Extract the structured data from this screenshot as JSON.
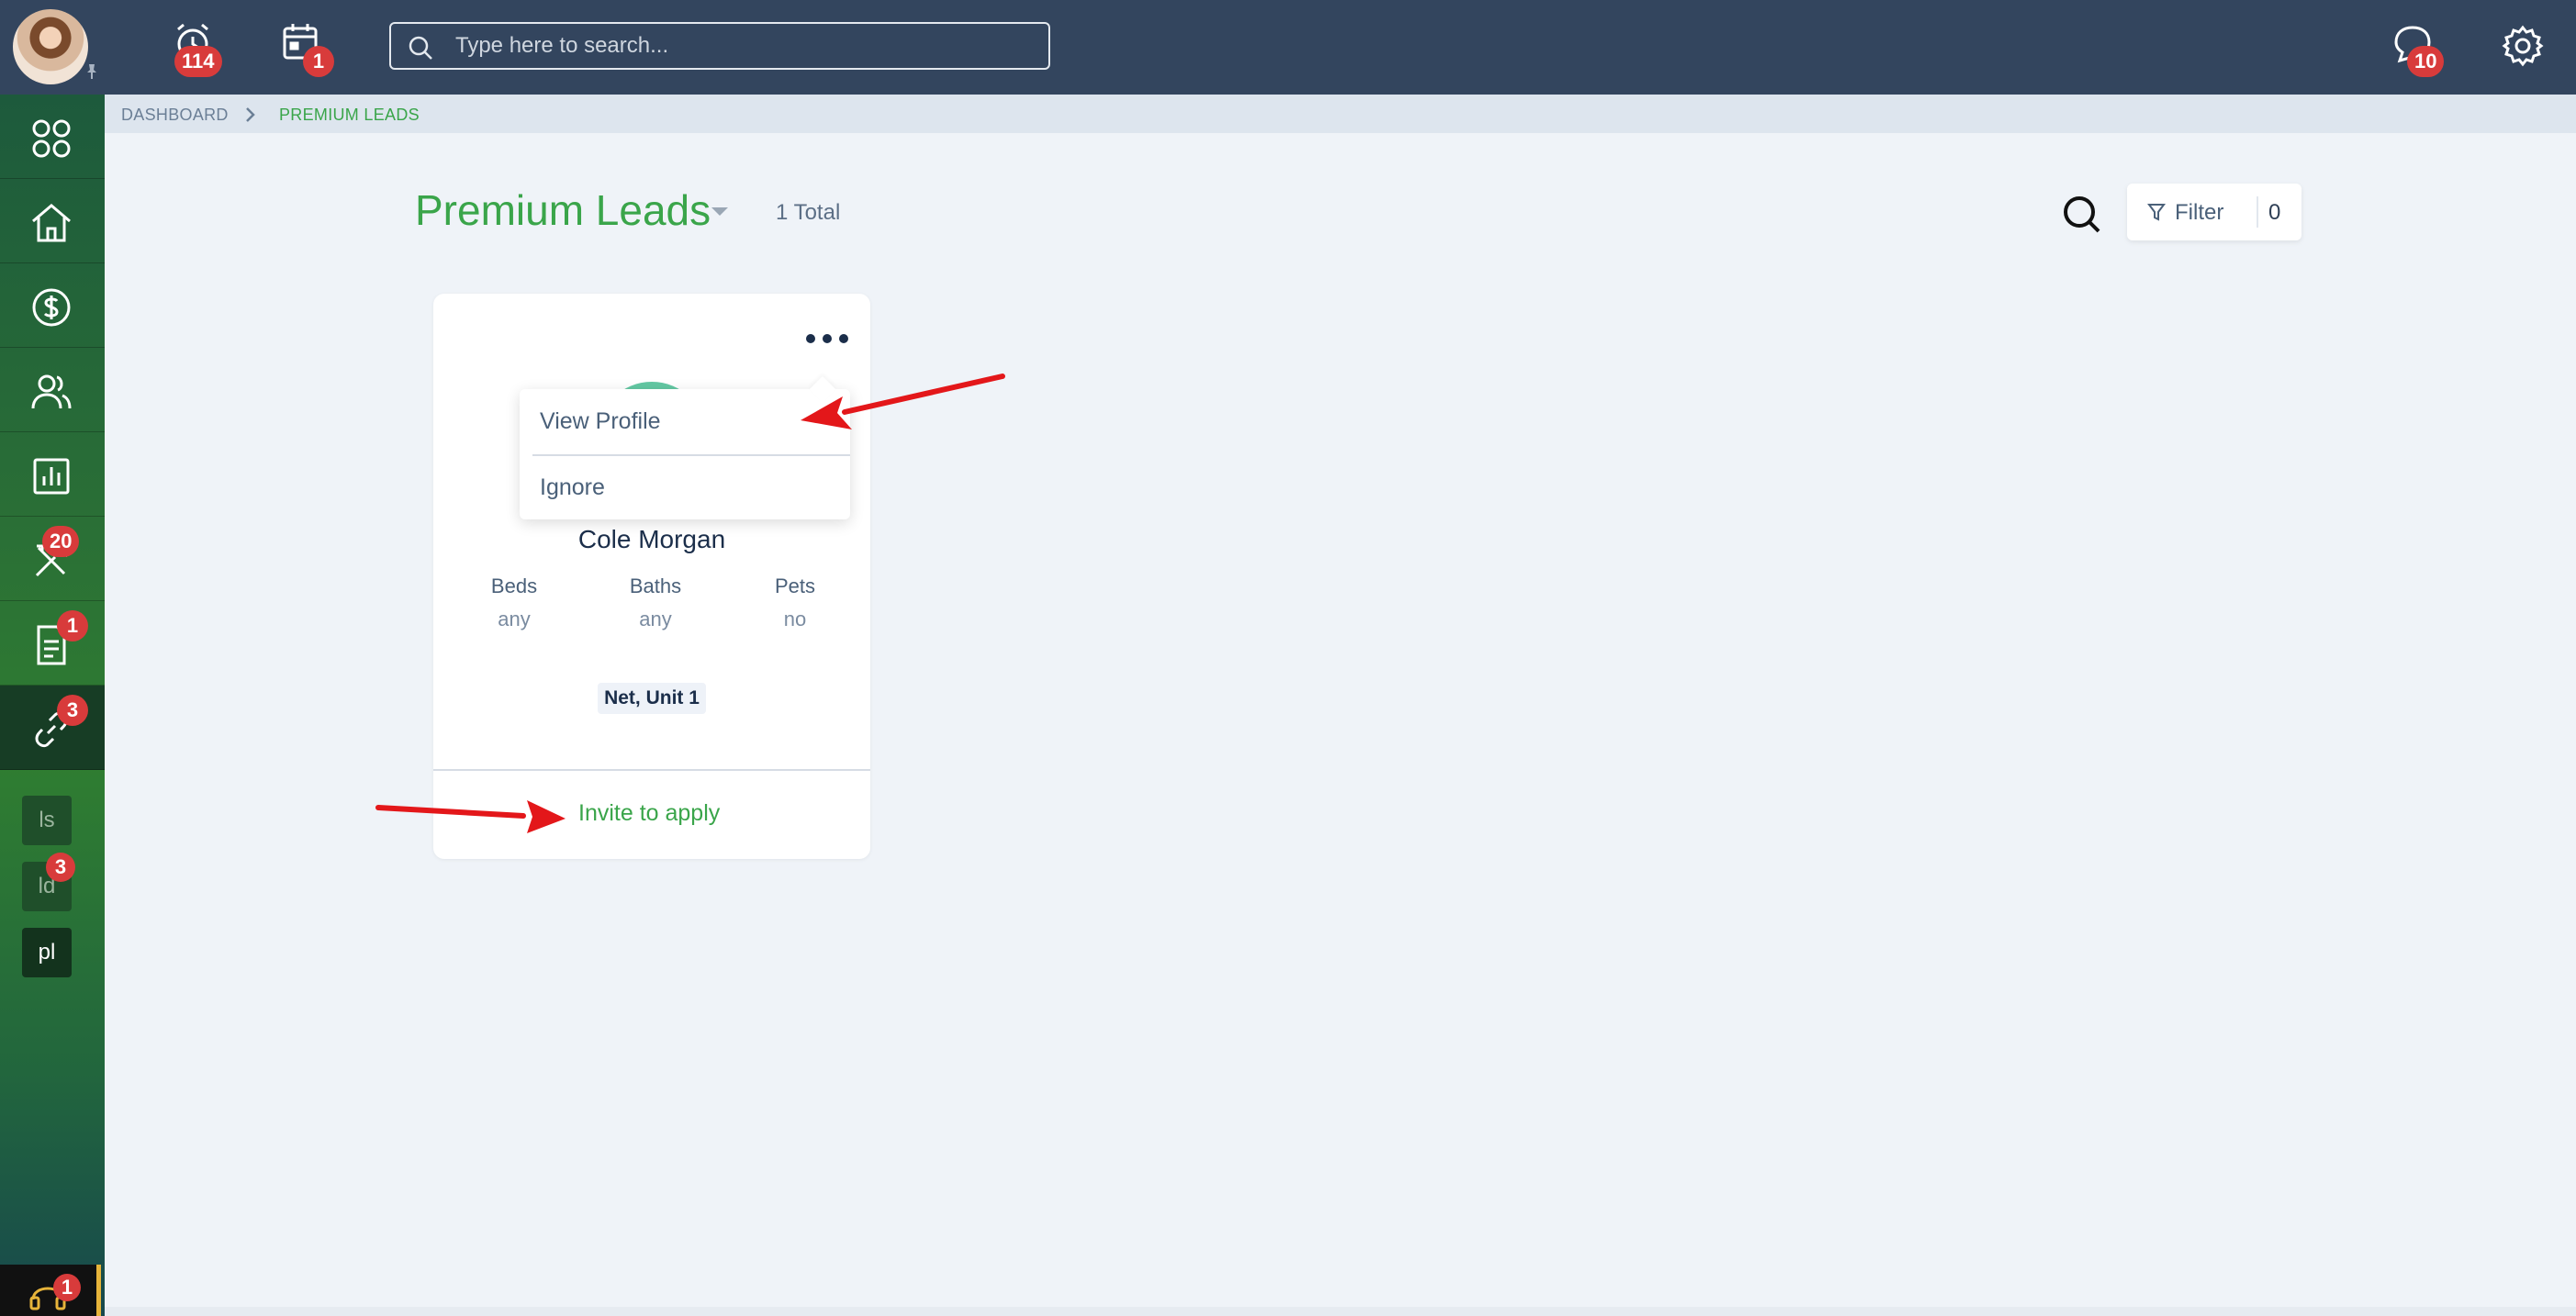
{
  "topbar": {
    "alerts_count": "114",
    "calendar_count": "1",
    "search_placeholder": "Type here to search...",
    "messages_count": "10"
  },
  "sidebar": {
    "maintenance_count": "20",
    "documents_count": "1",
    "links_count": "3",
    "shortcuts": [
      {
        "label": "ls",
        "count": ""
      },
      {
        "label": "ld",
        "count": "3"
      },
      {
        "label": "pl",
        "count": ""
      }
    ],
    "support_count": "1"
  },
  "breadcrumb": {
    "root": "DASHBOARD",
    "current": "PREMIUM LEADS"
  },
  "page": {
    "title": "Premium Leads",
    "total": "1 Total",
    "filter_label": "Filter",
    "filter_count": "0"
  },
  "lead_card": {
    "name": "Cole Morgan",
    "stats": [
      {
        "label": "Beds",
        "value": "any"
      },
      {
        "label": "Baths",
        "value": "any"
      },
      {
        "label": "Pets",
        "value": "no"
      }
    ],
    "unit": "Net, Unit 1",
    "action_label": "Invite to apply"
  },
  "menu": {
    "items": [
      "View Profile",
      "Ignore"
    ]
  },
  "colors": {
    "accent_green": "#3aa54a",
    "topbar_bg": "#33455e",
    "badge_red": "#d83b3b",
    "annotation_red": "#e3171a"
  }
}
